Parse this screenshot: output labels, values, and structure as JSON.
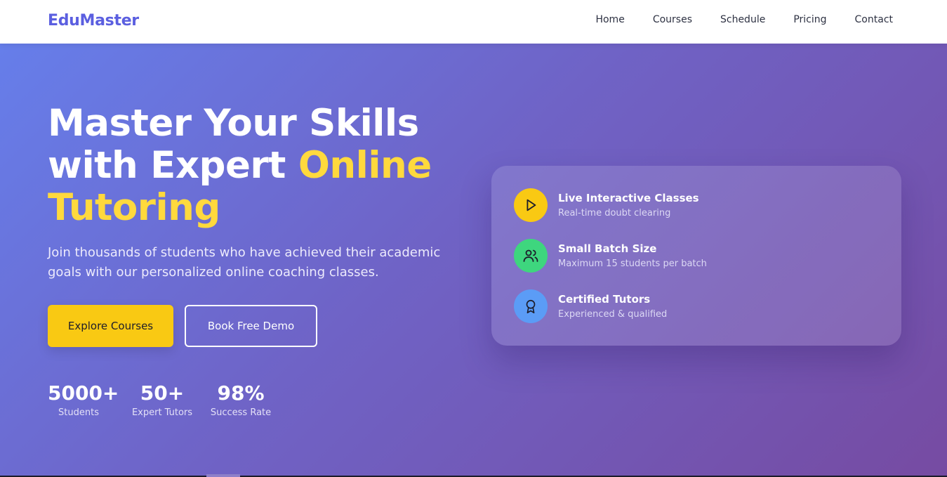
{
  "brand": {
    "name": "EduMaster",
    "color": "#5b5fe0"
  },
  "nav": {
    "links": [
      {
        "label": "Home"
      },
      {
        "label": "Courses"
      },
      {
        "label": "Schedule"
      },
      {
        "label": "Pricing"
      },
      {
        "label": "Contact"
      }
    ]
  },
  "hero": {
    "title_line1": "Master Your Skills",
    "title_line2_plain": "with Expert ",
    "title_line2_accent": "Online",
    "title_line3_accent": "Tutoring",
    "subtitle": "Join thousands of students who have achieved their academic goals with our personalized online coaching classes.",
    "primary_button": "Explore Courses",
    "secondary_button": "Book Free Demo",
    "stats": [
      {
        "value": "5000+",
        "label": "Students"
      },
      {
        "value": "50+",
        "label": "Expert Tutors"
      },
      {
        "value": "98%",
        "label": "Success Rate"
      }
    ]
  },
  "features": [
    {
      "title": "Live Interactive Classes",
      "desc": "Real-time doubt clearing",
      "icon": "play-icon",
      "color": "#f9c913"
    },
    {
      "title": "Small Batch Size",
      "desc": "Maximum 15 students per batch",
      "icon": "users-icon",
      "color": "#3ed67e"
    },
    {
      "title": "Certified Tutors",
      "desc": "Experienced & qualified",
      "icon": "award-icon",
      "color": "#5b9cf6"
    }
  ],
  "colors": {
    "accent": "#ffd93d",
    "gradient_start": "#667eea",
    "gradient_end": "#764ba2"
  }
}
